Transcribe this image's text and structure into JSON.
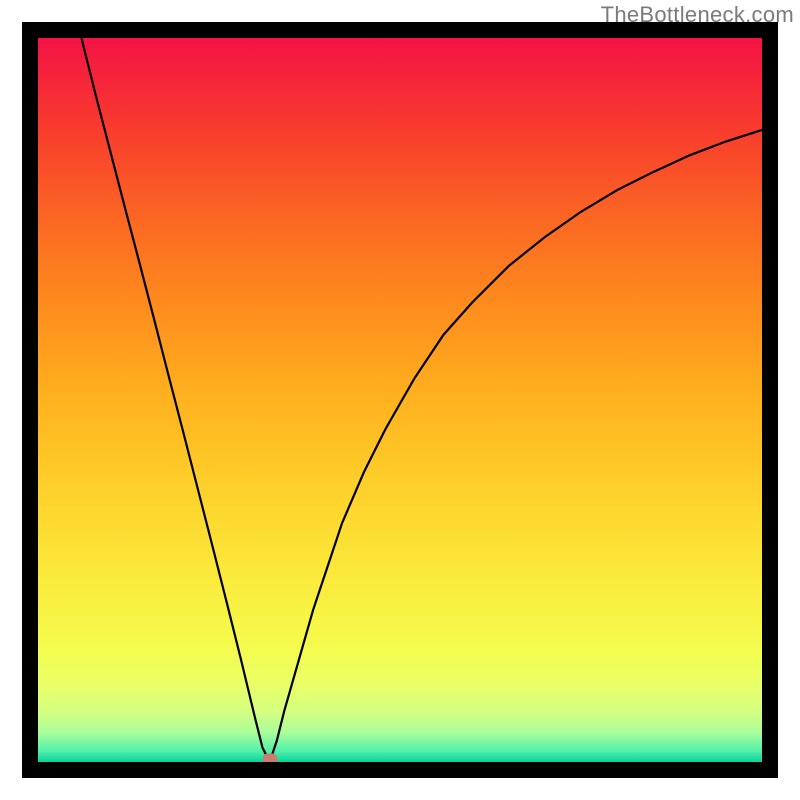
{
  "watermark": "TheBottleneck.com",
  "chart_data": {
    "type": "line",
    "title": "",
    "xlabel": "",
    "ylabel": "",
    "xlim": [
      0,
      100
    ],
    "ylim": [
      0,
      100
    ],
    "minimum": {
      "x": 32,
      "y": 0
    },
    "series": [
      {
        "name": "left-branch",
        "x": [
          6,
          8,
          10,
          12,
          14,
          16,
          18,
          20,
          22,
          24,
          26,
          28,
          30,
          31,
          32
        ],
        "y": [
          100,
          92,
          84.3,
          76.6,
          69,
          61.3,
          53.5,
          45.8,
          38,
          30.2,
          22.3,
          14.3,
          6,
          2,
          0
        ]
      },
      {
        "name": "right-branch",
        "x": [
          32,
          33,
          34,
          36,
          38,
          40,
          42,
          45,
          48,
          52,
          56,
          60,
          65,
          70,
          75,
          80,
          85,
          90,
          95,
          100
        ],
        "y": [
          0,
          3,
          7,
          14,
          21,
          27,
          33,
          40,
          46,
          53,
          59,
          63.5,
          68.5,
          72.5,
          76,
          79,
          81.5,
          83.8,
          85.7,
          87.3
        ]
      }
    ],
    "gradient_stops": [
      {
        "pos": 0.0,
        "color": "#f31245"
      },
      {
        "pos": 0.12,
        "color": "#f83a2e"
      },
      {
        "pos": 0.25,
        "color": "#fb6723"
      },
      {
        "pos": 0.38,
        "color": "#fe8f1d"
      },
      {
        "pos": 0.5,
        "color": "#ffb21f"
      },
      {
        "pos": 0.62,
        "color": "#fed02a"
      },
      {
        "pos": 0.74,
        "color": "#fbe93a"
      },
      {
        "pos": 0.84,
        "color": "#f4fb4d"
      },
      {
        "pos": 0.89,
        "color": "#ebff65"
      },
      {
        "pos": 0.93,
        "color": "#d5ff80"
      },
      {
        "pos": 0.96,
        "color": "#a8fe9b"
      },
      {
        "pos": 0.985,
        "color": "#50f0aa"
      },
      {
        "pos": 1.0,
        "color": "#07d39a"
      }
    ],
    "marker_color": "#c97d70"
  }
}
